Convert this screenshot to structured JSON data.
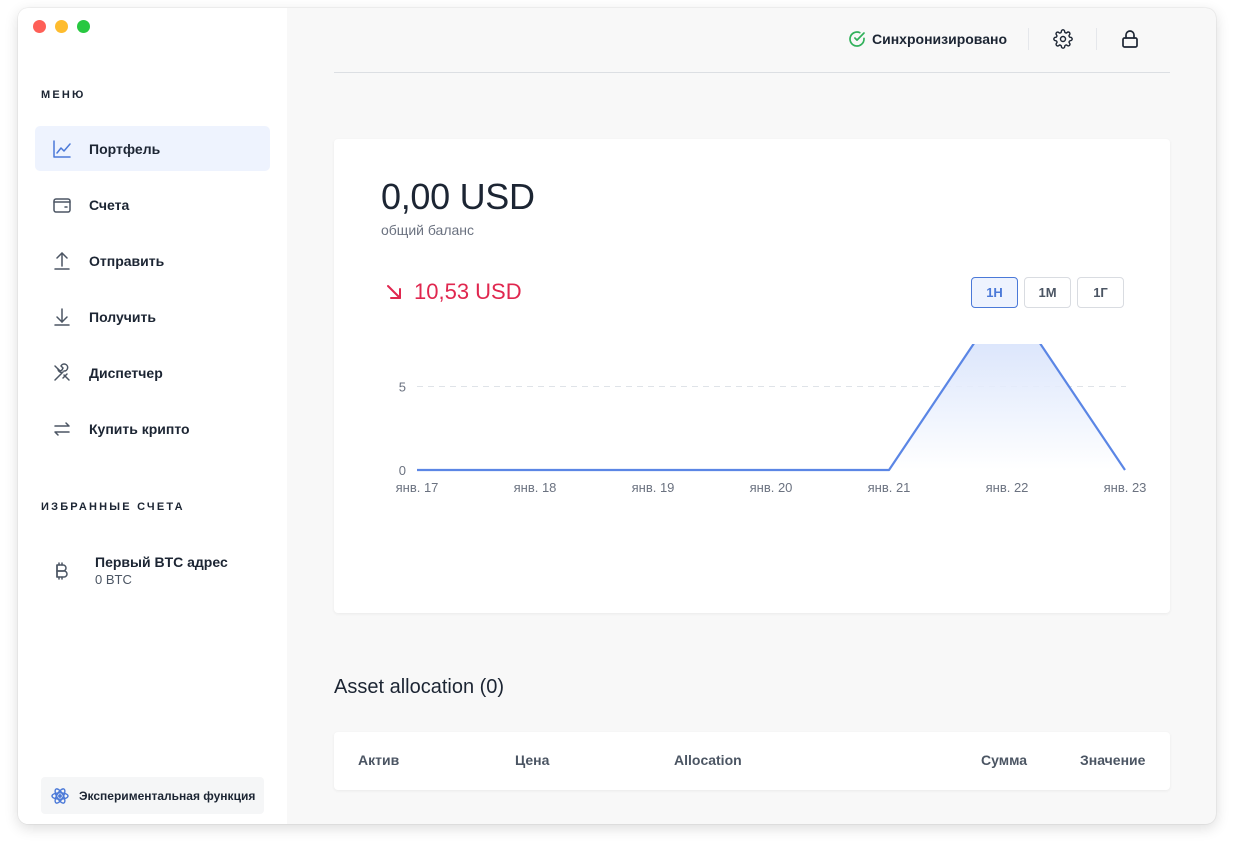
{
  "sidebar": {
    "menu_title": "МЕНЮ",
    "items": [
      {
        "label": "Портфель",
        "icon": "chart-line-icon",
        "active": true
      },
      {
        "label": "Счета",
        "icon": "wallet-icon"
      },
      {
        "label": "Отправить",
        "icon": "arrow-up-icon"
      },
      {
        "label": "Получить",
        "icon": "arrow-down-icon"
      },
      {
        "label": "Диспетчер",
        "icon": "tools-icon"
      },
      {
        "label": "Купить крипто",
        "icon": "exchange-icon"
      }
    ],
    "favorites_title": "ИЗБРАННЫЕ СЧЕТА",
    "favorites": [
      {
        "name": "Первый BTC адрес",
        "balance": "0 BTC",
        "icon": "bitcoin-icon"
      }
    ],
    "experimental_label": "Экспериментальная функция"
  },
  "header": {
    "sync_status": "Синхронизировано"
  },
  "portfolio": {
    "balance": "0,00 USD",
    "balance_label": "общий баланс",
    "change": "10,53 USD",
    "ranges": [
      "1Н",
      "1М",
      "1Г"
    ],
    "active_range": "1Н"
  },
  "chart_data": {
    "type": "area",
    "categories": [
      "янв. 17",
      "янв. 18",
      "янв. 19",
      "янв. 20",
      "янв. 21",
      "янв. 22",
      "янв. 23"
    ],
    "x": [
      0,
      0.5,
      1,
      1.5,
      2,
      2.5,
      3,
      3.5,
      4,
      5,
      6
    ],
    "values": [
      0,
      0,
      0,
      0,
      0,
      0,
      0,
      0,
      0,
      10.53,
      0
    ],
    "yticks": [
      0,
      5,
      10
    ],
    "ylim": [
      0,
      12
    ],
    "grid": true,
    "colors": {
      "line": "#5b86e5",
      "fill_top": "#c7d7fa",
      "fill_bottom": "#ffffff"
    }
  },
  "allocation": {
    "title": "Asset allocation (0)",
    "columns": [
      "Актив",
      "Цена",
      "Allocation",
      "Сумма",
      "Значение"
    ]
  },
  "colors": {
    "accent": "#4b79d8",
    "negative": "#e0274f",
    "success": "#31b15b"
  }
}
